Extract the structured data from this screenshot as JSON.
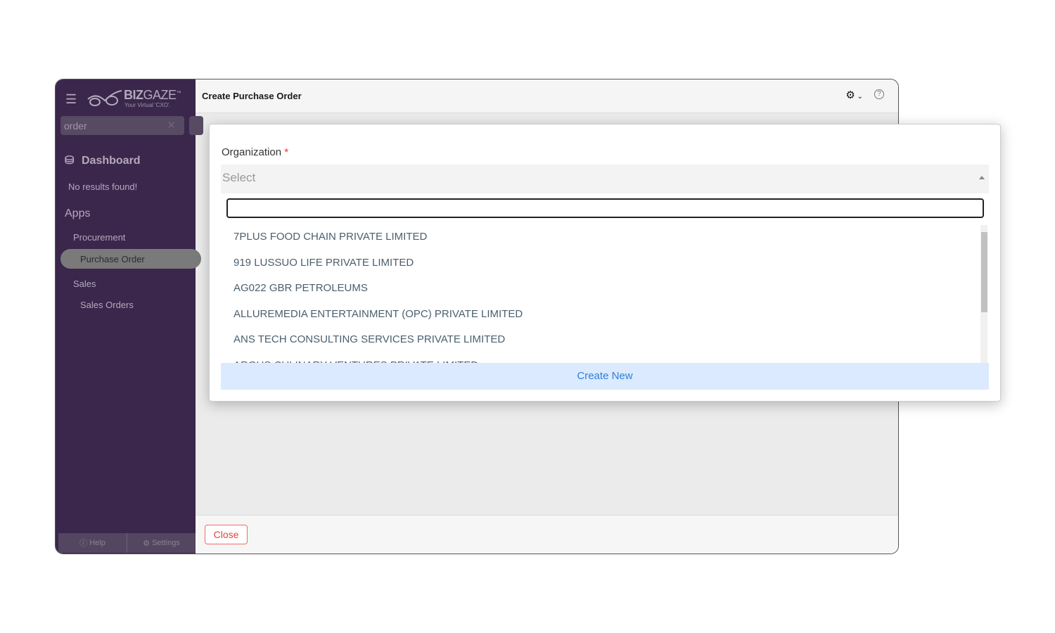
{
  "sidebar": {
    "logo": {
      "name_bold": "BIZ",
      "name_light": "GAZE",
      "tm": "™",
      "tagline": "Your Virtual 'CXO'."
    },
    "search_value": "order",
    "dashboard": "Dashboard",
    "no_results": "No results found!",
    "apps": "Apps",
    "procurement": "Procurement",
    "purchase_order": "Purchase Order",
    "sales": "Sales",
    "sales_orders": "Sales Orders",
    "help": "Help",
    "settings": "Settings"
  },
  "header": {
    "title": "Create Purchase Order"
  },
  "footer": {
    "close": "Close"
  },
  "dialog": {
    "label": "Organization",
    "required": "*",
    "select_placeholder": "Select",
    "search_value": "",
    "options": [
      "7PLUS FOOD CHAIN PRIVATE LIMITED",
      "919 LUSSUO LIFE PRIVATE LIMITED",
      "AG022 GBR PETROLEUMS",
      "ALLUREMEDIA ENTERTAINMENT (OPC) PRIVATE LIMITED",
      "ANS TECH CONSULTING SERVICES PRIVATE LIMITED",
      "ARGUS CULINARY VENTURES PRIVATE LIMITED"
    ],
    "create_new": "Create New"
  },
  "colors": {
    "sidebar": "#3b264c",
    "accent": "#2e7fd8",
    "danger": "#e8403e"
  }
}
